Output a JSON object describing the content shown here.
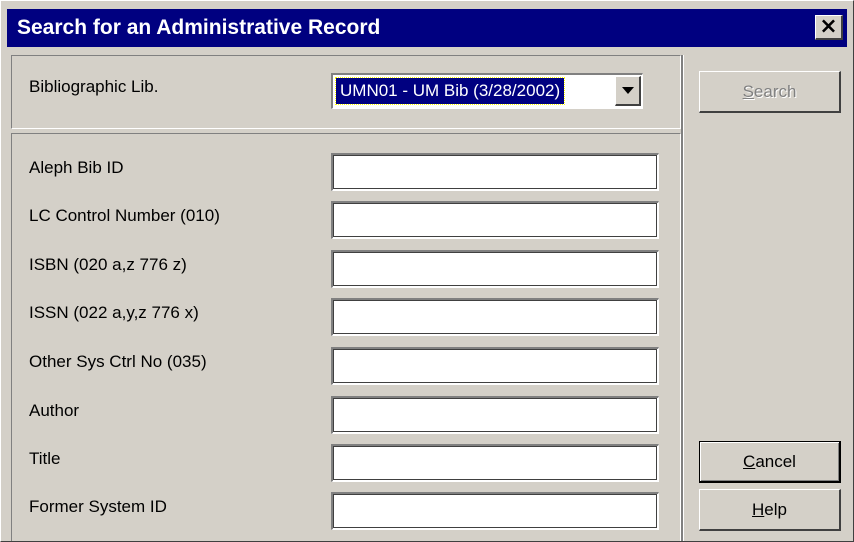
{
  "window": {
    "title": "Search for an Administrative Record",
    "close_glyph": "×"
  },
  "library": {
    "label": "Bibliographic Lib.",
    "selected": "UMN01 - UM Bib (3/28/2002)"
  },
  "fields": [
    {
      "label": "Aleph Bib ID",
      "value": ""
    },
    {
      "label": "LC Control Number (010)",
      "value": ""
    },
    {
      "label": "ISBN (020 a,z 776 z)",
      "value": ""
    },
    {
      "label": "ISSN (022 a,y,z 776 x)",
      "value": ""
    },
    {
      "label": "Other Sys Ctrl No (035)",
      "value": ""
    },
    {
      "label": "Author",
      "value": ""
    },
    {
      "label": "Title",
      "value": ""
    },
    {
      "label": "Former System ID",
      "value": ""
    }
  ],
  "buttons": {
    "search": {
      "first": "S",
      "rest": "earch",
      "enabled": false
    },
    "cancel": {
      "first": "C",
      "rest": "ancel"
    },
    "help": {
      "first": "H",
      "rest": "elp"
    }
  },
  "colors": {
    "titlebar": "#000080",
    "face": "#d4d0c8",
    "selection": "#000080"
  }
}
